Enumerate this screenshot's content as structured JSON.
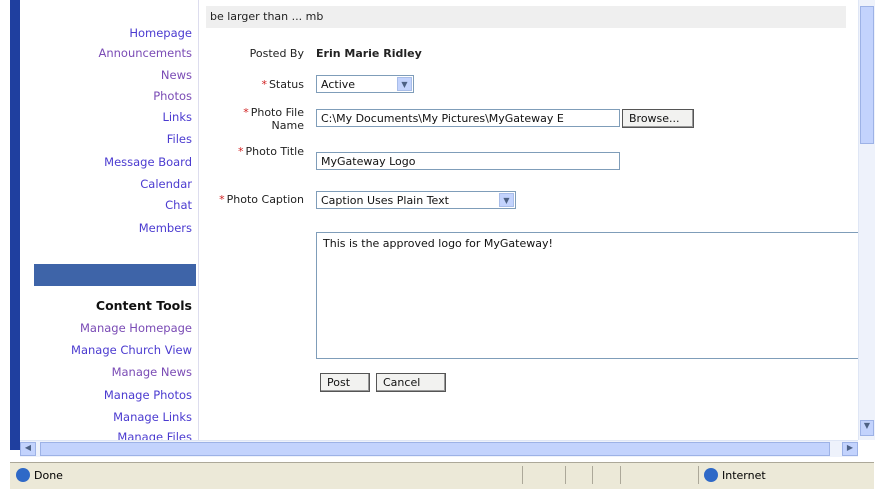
{
  "sidebar": {
    "nav_links": [
      "Homepage",
      "Announcements",
      "News",
      "Photos",
      "Links",
      "Files",
      "Message Board",
      "Calendar",
      "Chat",
      "Members"
    ],
    "content_tools_title": "Content Tools",
    "tool_links": [
      "Manage Homepage",
      "Manage Church View",
      "Manage News",
      "Manage Photos",
      "Manage Links",
      "Manage Files"
    ]
  },
  "form": {
    "top_note": "be larger than ... mb",
    "posted_by_label": "Posted By",
    "posted_by_value": "Erin   Marie Ridley",
    "status_label": "Status",
    "status_value": "Active",
    "photo_file_label": "Photo File Name",
    "photo_file_value": "C:\\My Documents\\My Pictures\\MyGateway E",
    "browse_label": "Browse...",
    "photo_title_label": "Photo Title",
    "photo_title_value": "MyGateway Logo",
    "photo_caption_label": "Photo Caption",
    "caption_type_value": "Caption Uses Plain Text",
    "caption_text": "This is the approved logo for MyGateway!",
    "post_label": "Post",
    "cancel_label": "Cancel"
  },
  "statusbar": {
    "left_text": "Done",
    "zone_text": "Internet"
  },
  "colors": {
    "sidebar_band": "#3e64a8",
    "required_star": "#d02020",
    "link": "#4b3bd0"
  }
}
